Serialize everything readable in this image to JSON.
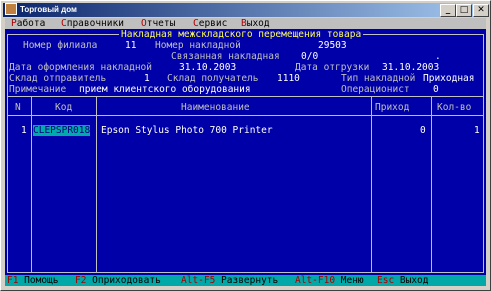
{
  "window": {
    "title": "Торговый дом",
    "min": "_",
    "max": "□",
    "close": "✕"
  },
  "menu": {
    "items": [
      {
        "hot": "Р",
        "rest": "абота"
      },
      {
        "hot": "С",
        "rest": "правочники"
      },
      {
        "hot": "О",
        "rest": "тчеты"
      },
      {
        "hot": "С",
        "rest": "ервис"
      },
      {
        "hot": "В",
        "rest": "ыход"
      }
    ]
  },
  "form": {
    "title": "Накладная межскладского перемещения товара",
    "branch_label": "Номер филиала",
    "branch_value": "11",
    "invoice_label": "Номер накладной",
    "invoice_value": "29503",
    "linked_label": "Связанная накладная",
    "linked_value": "0/0",
    "linked_extra": ".",
    "date_created_label": "Дата оформления накладной",
    "date_created_value": "31.10.2003",
    "date_shipped_label": "Дата отгрузки",
    "date_shipped_value": "31.10.2003",
    "sender_label": "Склад отправитель",
    "sender_value": "1",
    "receiver_label": "Склад получатель",
    "receiver_value": "1110",
    "type_label": "Тип накладной",
    "type_value": "Приходная",
    "note_label": "Примечание",
    "note_value": "прием клиентского оборудования",
    "operator_label": "Операционист",
    "operator_value": "0"
  },
  "table": {
    "headers": {
      "n": "N",
      "code": "Код",
      "name": "Наименование",
      "income": "Приход",
      "qty": "Кол-во"
    },
    "rows": [
      {
        "n": "1",
        "code": "CLEPSPR018",
        "name": "Epson Stylus Photo 700 Printer",
        "income": "0",
        "qty": "1"
      }
    ]
  },
  "status": {
    "items": [
      {
        "key": "F1",
        "label": " Помощь"
      },
      {
        "key": "F2",
        "label": " Оприходовать"
      },
      {
        "key": "Alt-F5",
        "label": " Развернуть"
      },
      {
        "key": "Alt-F10",
        "label": " Меню"
      },
      {
        "key": "Esc",
        "label": " Выход"
      }
    ]
  },
  "colors": {
    "console_bg": "#0000a8",
    "menubar_bg": "#bfbfbf",
    "statusbar_bg": "#00a8a8",
    "accent_yellow": "#ffff55",
    "hotkey_red": "#a80000"
  }
}
